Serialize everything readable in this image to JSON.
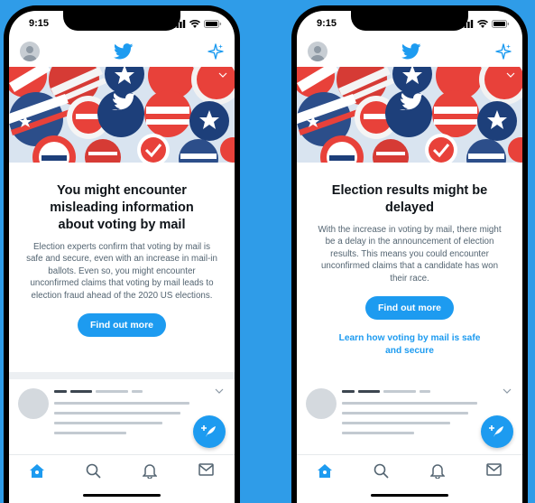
{
  "colors": {
    "accent": "#1d9bf0",
    "background": "#2f9ce8",
    "text": "#0f1419",
    "muted": "#536471"
  },
  "icons": {
    "signal": "cellular-signal-icon",
    "wifi": "wifi-icon",
    "battery": "battery-icon",
    "brand": "twitter-bird-icon",
    "sparkle": "sparkle-icon",
    "home": "home-icon",
    "search": "search-icon",
    "notifications": "bell-icon",
    "messages": "mail-icon",
    "compose": "compose-tweet-icon"
  },
  "left_phone": {
    "status": {
      "time": "9:15"
    },
    "prompt": {
      "title": "You might encounter misleading information about voting by mail",
      "body": "Election experts confirm that voting by mail is safe and secure, even with an increase in mail-in ballots. Even so, you might encounter unconfirmed claims that voting by mail leads to election fraud ahead of the 2020 US elections.",
      "button": "Find out more"
    }
  },
  "right_phone": {
    "status": {
      "time": "9:15"
    },
    "prompt": {
      "title": "Election results might be delayed",
      "body": "With the increase in voting by mail, there might be a delay in the announcement of election results. This means you could encounter unconfirmed claims that a candidate has won their race.",
      "button": "Find out more",
      "link": "Learn how voting by mail is safe and secure"
    }
  }
}
